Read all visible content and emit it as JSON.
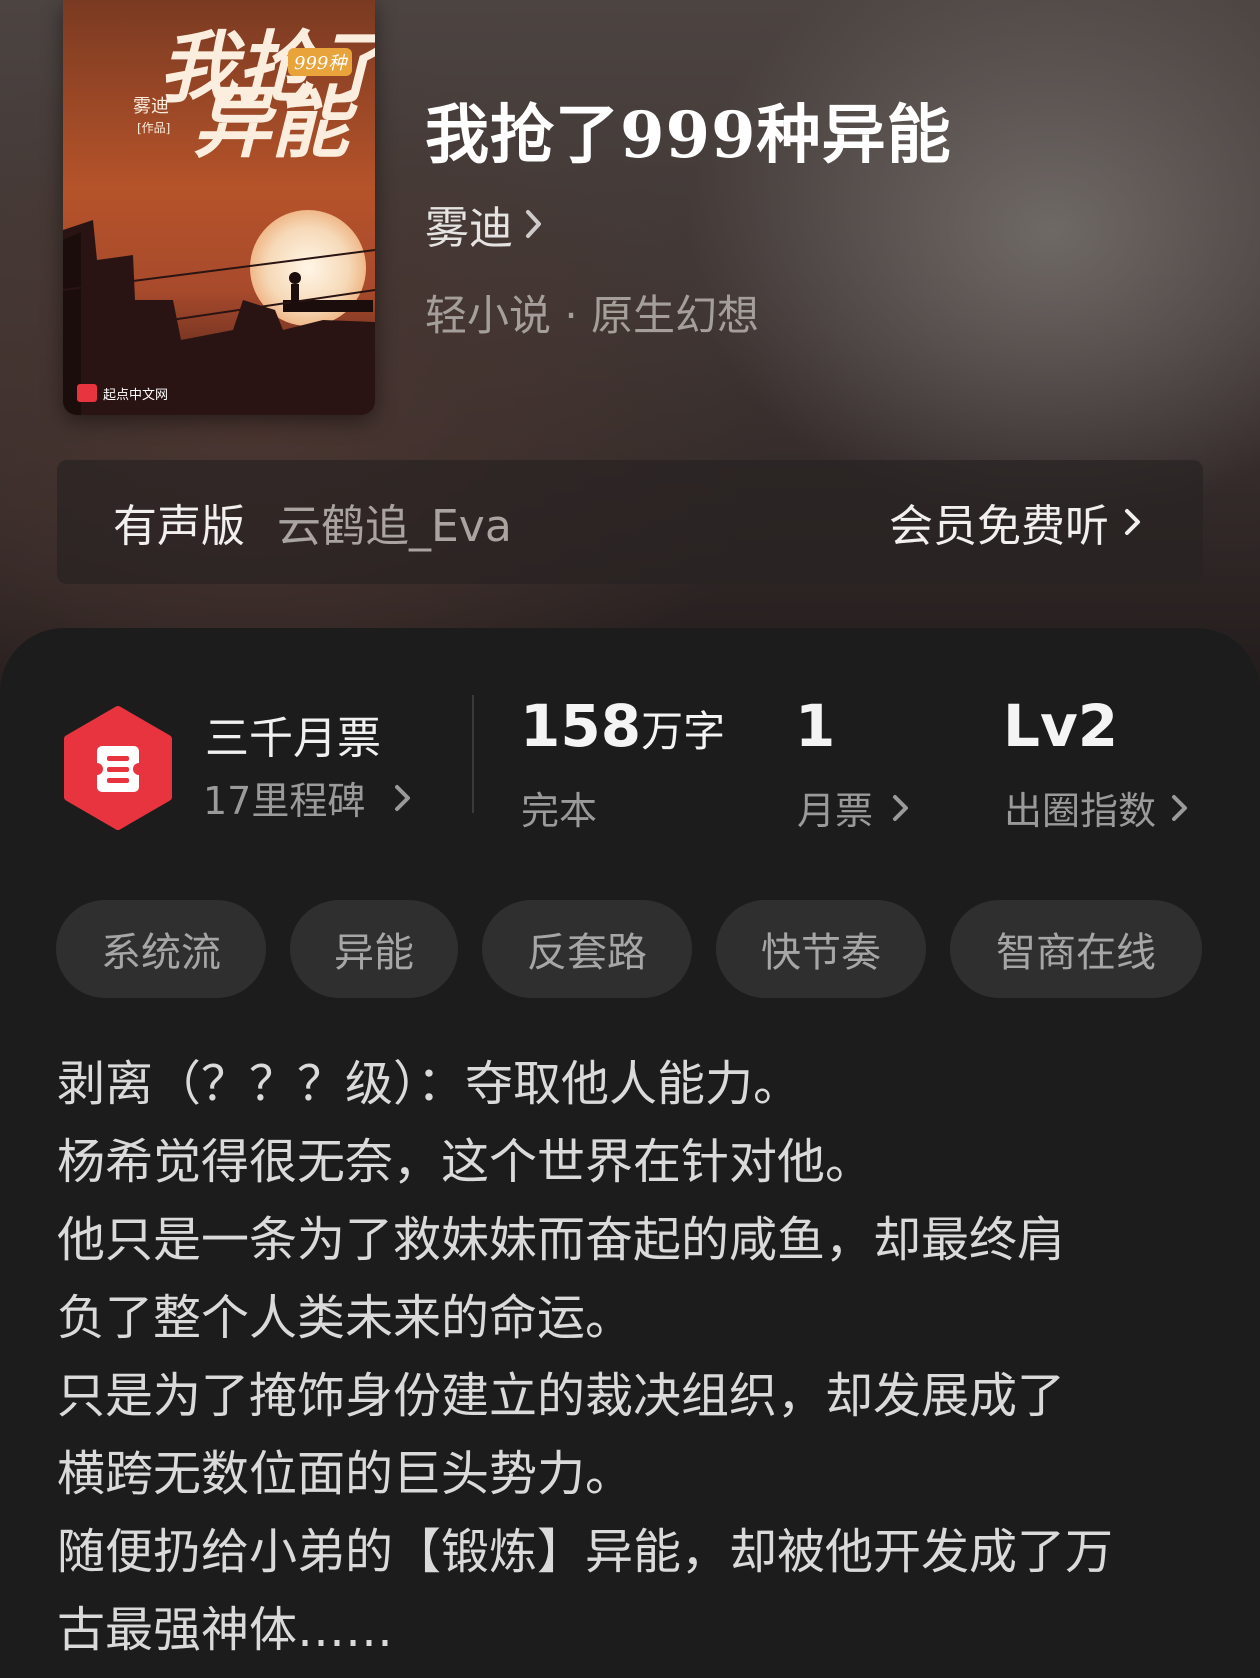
{
  "book": {
    "title": "我抢了999种异能",
    "author": "雾迪",
    "genre": "轻小说 · 原生幻想",
    "cover": {
      "title_line1": "我抢了",
      "title_line2": "异能",
      "badge": "999种",
      "author": "雾迪",
      "author_note": "[作品]",
      "publisher": "起点中文网"
    }
  },
  "audio": {
    "label": "有声版",
    "narrator": "云鹤追_Eva",
    "cta": "会员免费听"
  },
  "stats": {
    "milestone_title": "三千月票",
    "milestone_sub": "17里程碑",
    "word_count_num": "158",
    "word_count_unit": "万字",
    "status": "完本",
    "monthly_votes_num": "1",
    "monthly_votes_label": "月票",
    "index_num": "Lv2",
    "index_label": "出圈指数"
  },
  "tags": [
    "系统流",
    "异能",
    "反套路",
    "快节奏",
    "智商在线"
  ],
  "synopsis": [
    "剥离（？？？级）：夺取他人能力。",
    "杨希觉得很无奈，这个世界在针对他。",
    "他只是一条为了救妹妹而奋起的咸鱼，却最终肩",
    "负了整个人类未来的命运。",
    "只是为了掩饰身份建立的裁决组织，却发展成了",
    "横跨无数位面的巨头势力。",
    "随便扔给小弟的【锻炼】异能，却被他开发成了万",
    "古最强神体……"
  ],
  "colors": {
    "badge_red": "#e8343e",
    "sheet_bg": "#1c1c1d",
    "tag_bg": "#2f2f30"
  },
  "icons": {
    "chevron": "chevron-right-icon",
    "badge": "ticket-badge-icon"
  }
}
